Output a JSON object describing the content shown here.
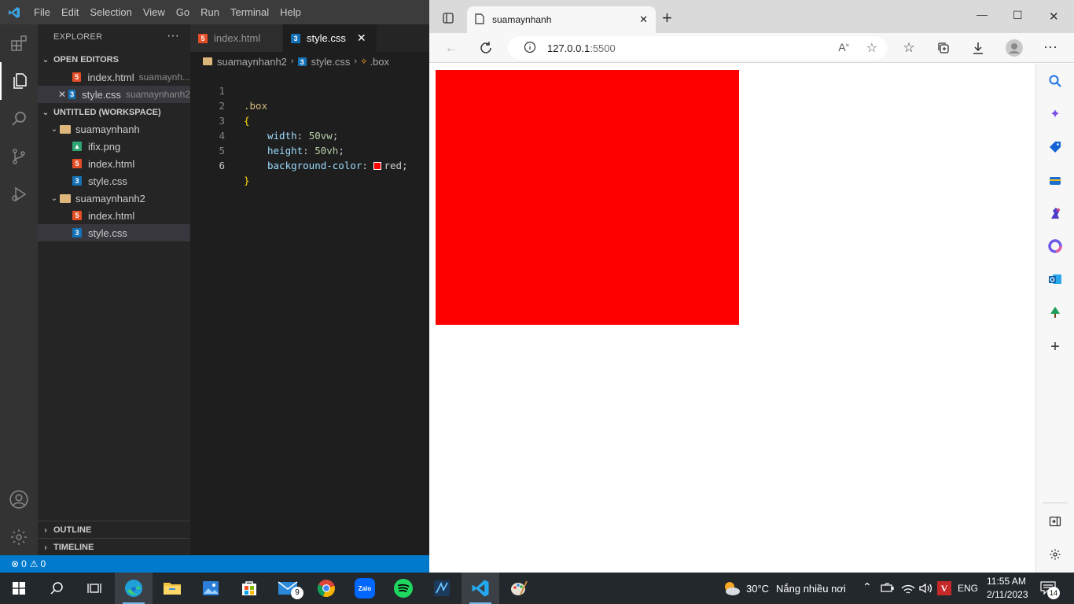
{
  "vscode": {
    "menu": [
      "File",
      "Edit",
      "Selection",
      "View",
      "Go",
      "Run",
      "Terminal",
      "Help"
    ],
    "explorer_title": "EXPLORER",
    "explorer_more": "···",
    "open_editors_title": "OPEN EDITORS",
    "open_editors": [
      {
        "name": "index.html",
        "desc": "suamaynh..."
      },
      {
        "name": "style.css",
        "desc": "suamaynhanh2",
        "close": "✕"
      }
    ],
    "workspace_title": "UNTITLED (WORKSPACE)",
    "folder1": {
      "name": "suamaynhanh",
      "files": [
        "ifix.png",
        "index.html",
        "style.css"
      ]
    },
    "folder2": {
      "name": "suamaynhanh2",
      "files": [
        "index.html",
        "style.css"
      ]
    },
    "outline_title": "OUTLINE",
    "timeline_title": "TIMELINE",
    "tabs": [
      {
        "label": "index.html"
      },
      {
        "label": "style.css",
        "close": "✕"
      }
    ],
    "breadcrumb": [
      "suamaynhanh2",
      "style.css",
      ".box"
    ],
    "code": {
      "line_numbers": [
        "1",
        "2",
        "3",
        "4",
        "5",
        "6"
      ],
      "l1": ".box",
      "l2": "{",
      "l3_prop": "width",
      "l3_val": "50vw",
      "l4_prop": "height",
      "l4_val": "50vh",
      "l5_prop": "background-color",
      "l5_val": "red",
      "l6": "}"
    },
    "status": {
      "errors": "0",
      "warnings": "0"
    }
  },
  "edge": {
    "tab_title": "suamaynhanh",
    "tab_close": "✕",
    "new_tab": "+",
    "url_host": "127.0.0.1",
    "url_port": ":5500",
    "box_color": "#ff0000",
    "window_controls": [
      "—",
      "☐",
      "✕"
    ]
  },
  "taskbar": {
    "weather_temp": "30°C",
    "weather_desc": "Nắng nhiều nơi",
    "lang": "ENG",
    "time": "11:55 AM",
    "date": "2/11/2023",
    "mail_badge": "9",
    "notif_count": "14",
    "zalo_label": "Zalo"
  }
}
